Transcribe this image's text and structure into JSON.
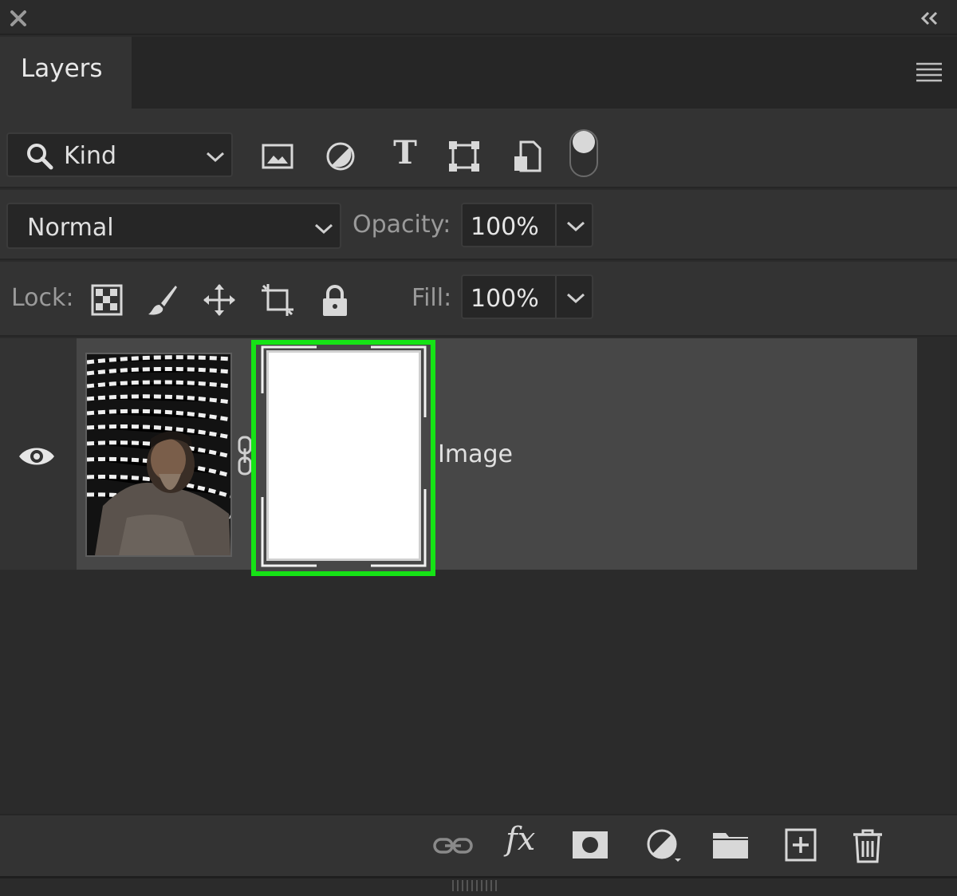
{
  "panel": {
    "tab_label": "Layers"
  },
  "filter": {
    "kind_label": "Kind",
    "icons": [
      "pixel-layer-filter-icon",
      "adjustment-layer-filter-icon",
      "type-layer-filter-icon",
      "shape-layer-filter-icon",
      "smart-object-filter-icon"
    ],
    "type_label": "T"
  },
  "blend": {
    "mode": "Normal",
    "opacity_label": "Opacity:",
    "opacity_value": "100%"
  },
  "lock": {
    "label": "Lock:",
    "fill_label": "Fill:",
    "fill_value": "100%"
  },
  "layers": [
    {
      "name": "Image",
      "visible": true,
      "has_mask": true,
      "mask_selected": true
    }
  ],
  "bottom_icons": [
    "link-layers-icon",
    "layer-style-fx-icon",
    "add-mask-icon",
    "adjustment-layer-icon",
    "group-folder-icon",
    "new-layer-icon",
    "trash-icon"
  ],
  "fx_label": "fx",
  "colors": {
    "panel_bg": "#333333",
    "selected_layer_bg": "#474747",
    "mask_highlight": "#16e316"
  }
}
